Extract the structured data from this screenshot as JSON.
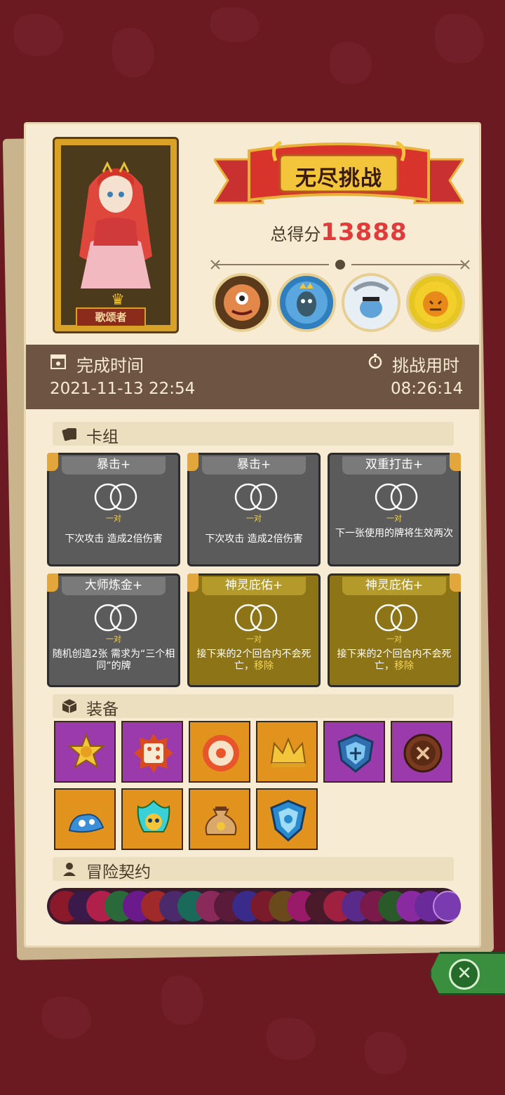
{
  "portrait": {
    "name": "歌颂者"
  },
  "banner": {
    "title": "无尽挑战"
  },
  "score": {
    "label": "总得分",
    "value": "13888"
  },
  "time": {
    "finish_label": "完成时间",
    "finish_value": "2021-11-13 22:54",
    "duration_label": "挑战用时",
    "duration_value": "08:26:14"
  },
  "deck": {
    "header": "卡组",
    "cards": [
      {
        "title": "暴击+",
        "sub": "一对",
        "desc": "下次攻击 造成2倍伤害",
        "style": "gray"
      },
      {
        "title": "暴击+",
        "sub": "一对",
        "desc": "下次攻击 造成2倍伤害",
        "style": "gray"
      },
      {
        "title": "双重打击+",
        "sub": "一对",
        "desc": "下一张使用的牌将生效两次",
        "style": "gray"
      },
      {
        "title": "大师炼金+",
        "sub": "一对",
        "desc": "随机创造2张 需求为“三个相同”的牌",
        "style": "gray"
      },
      {
        "title": "神灵庇佑+",
        "sub": "一对",
        "desc": "接下来的2个回合内不会死亡，",
        "remove": "移除",
        "style": "gold"
      },
      {
        "title": "神灵庇佑+",
        "sub": "一对",
        "desc": "接下来的2个回合内不会死亡，",
        "remove": "移除",
        "style": "gold"
      }
    ]
  },
  "equipment": {
    "header": "装备",
    "items": [
      {
        "icon": "sun-medal-icon",
        "color": "#9b3bab"
      },
      {
        "icon": "spiked-dice-icon",
        "color": "#9b3bab"
      },
      {
        "icon": "donut-ring-icon",
        "color": "#e2931d"
      },
      {
        "icon": "crown-icon",
        "color": "#e2931d"
      },
      {
        "icon": "blue-shield-icon",
        "color": "#9b3bab"
      },
      {
        "icon": "brown-button-icon",
        "color": "#9b3bab"
      },
      {
        "icon": "blue-slime-icon",
        "color": "#e2931d"
      },
      {
        "icon": "flame-skull-icon",
        "color": "#e2931d"
      },
      {
        "icon": "money-bag-icon",
        "color": "#e2931d"
      },
      {
        "icon": "crystal-shield-icon",
        "color": "#e2931d"
      }
    ]
  },
  "contracts": {
    "header": "冒险契约"
  },
  "close": {
    "label": "✕"
  }
}
